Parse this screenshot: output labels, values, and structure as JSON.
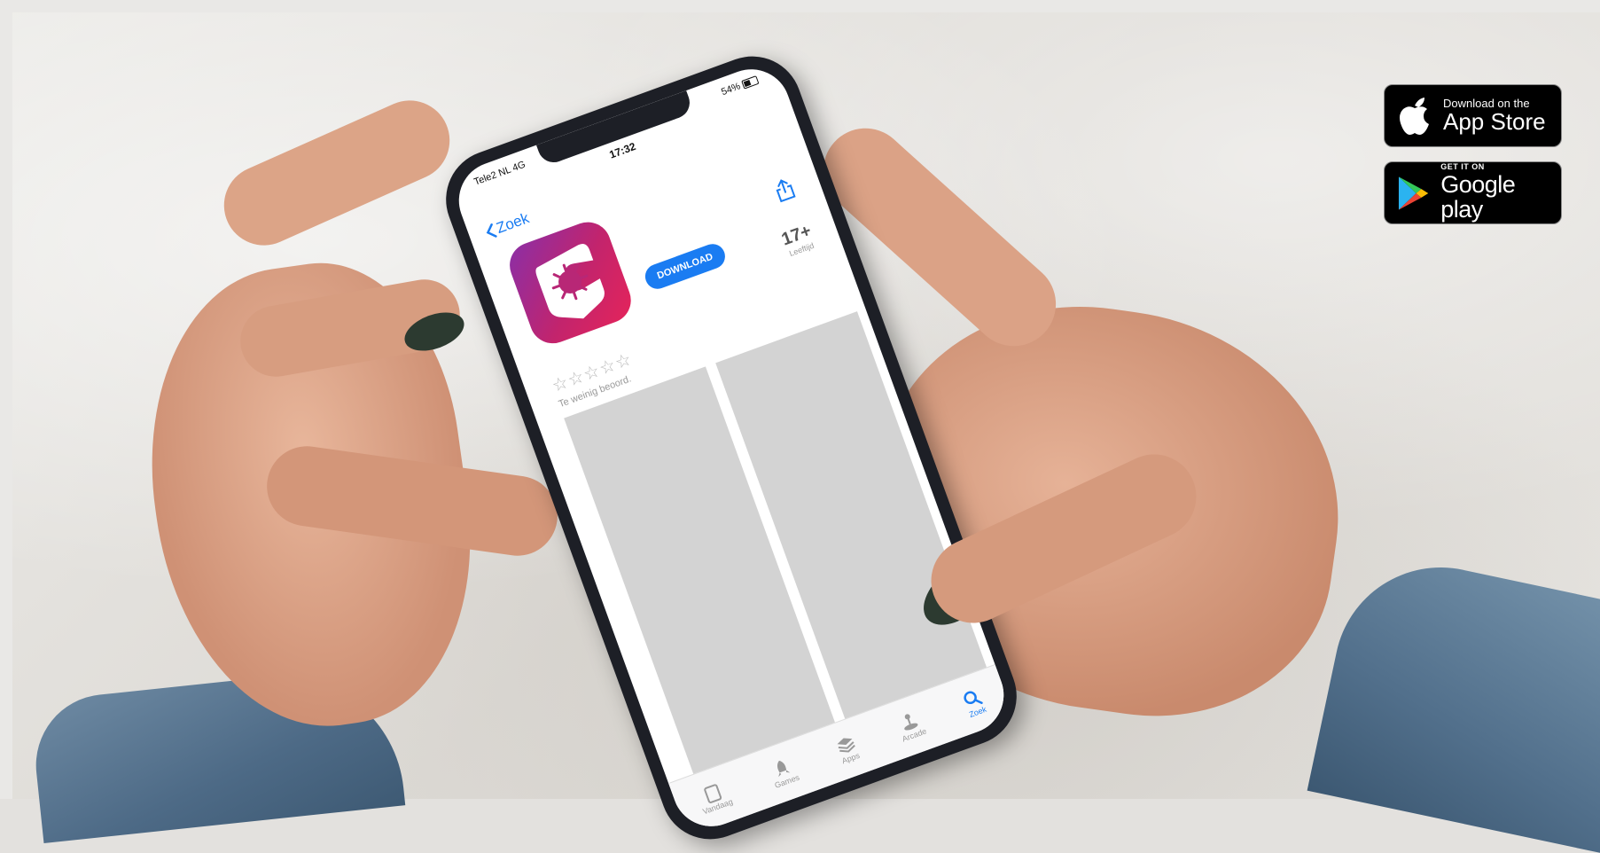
{
  "phone": {
    "status": {
      "carrier": "Tele2 NL  4G",
      "time": "17:32",
      "battery": "54%"
    },
    "back_label": "Zoek",
    "download_label": "DOWNLOAD",
    "age": {
      "value": "17+",
      "label": "Leeftijd"
    },
    "stars": "☆☆☆☆☆",
    "rating_text": "Te weinig beoord.",
    "tabs": [
      {
        "label": "Vandaag",
        "icon": "today-icon"
      },
      {
        "label": "Games",
        "icon": "rocket-icon"
      },
      {
        "label": "Apps",
        "icon": "stack-icon"
      },
      {
        "label": "Arcade",
        "icon": "joystick-icon"
      },
      {
        "label": "Zoek",
        "icon": "search-icon"
      }
    ]
  },
  "badges": {
    "app_store": {
      "small": "Download on the",
      "big": "App Store"
    },
    "google_play": {
      "small": "GET IT ON",
      "big": "Google play"
    }
  },
  "colors": {
    "ios_blue": "#1a7cf2",
    "app_gradient_start": "#8a2fa7",
    "app_gradient_end": "#e5245a"
  }
}
